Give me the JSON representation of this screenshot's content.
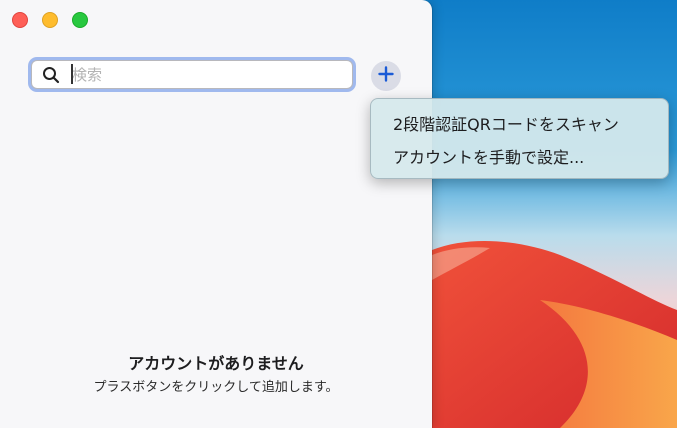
{
  "search": {
    "placeholder": "検索"
  },
  "toolbar": {
    "add_button_icon": "plus-icon"
  },
  "add_menu": {
    "items": [
      {
        "label": "2段階認証QRコードをスキャン"
      },
      {
        "label": "アカウントを手動で設定..."
      }
    ]
  },
  "empty_state": {
    "title": "アカウントがありません",
    "subtitle": "プラスボタンをクリックして追加します。"
  },
  "colors": {
    "accent": "#1b5bd6",
    "close": "#fe5f57",
    "minimize": "#febc2e",
    "zoom": "#28c840",
    "focus_ring": "#5986e6",
    "menu_background": "#d6e9ec"
  }
}
